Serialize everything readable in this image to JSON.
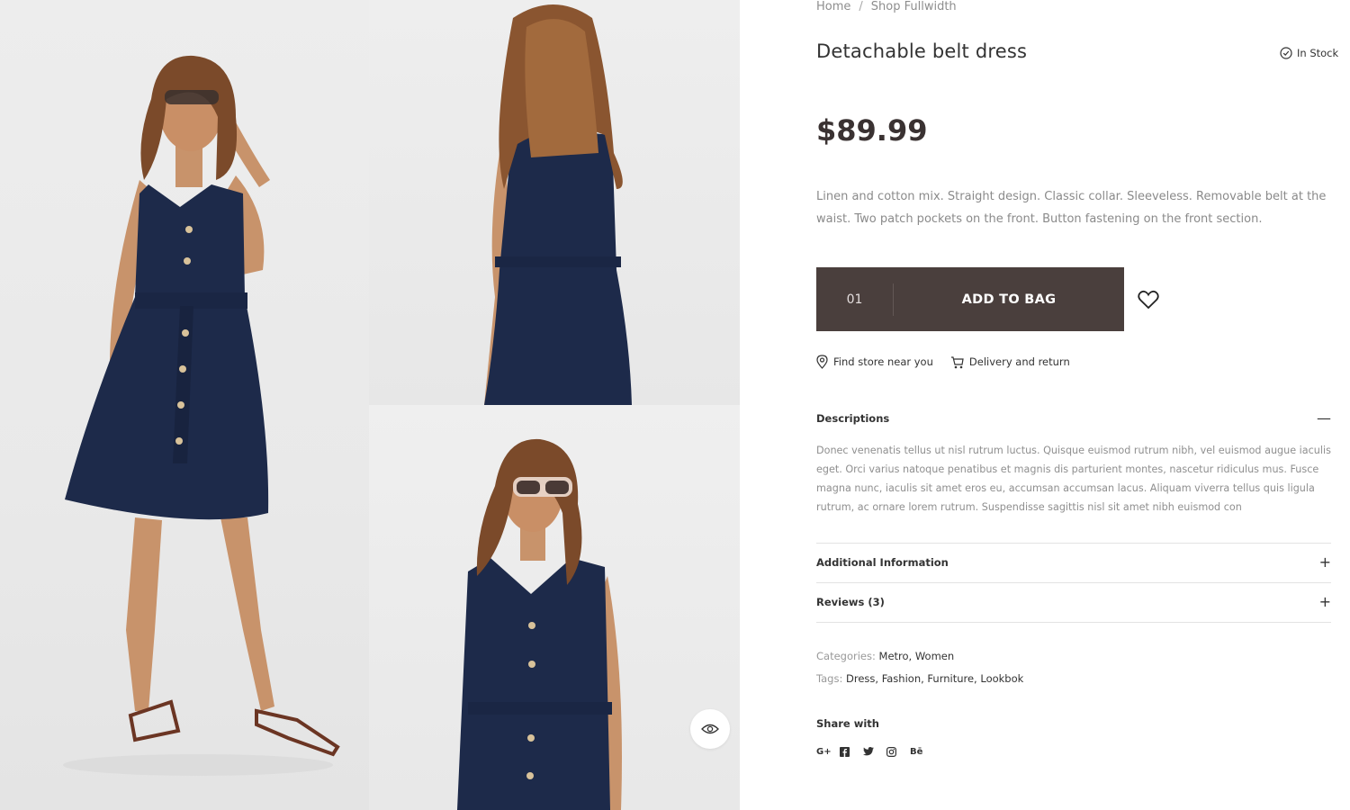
{
  "breadcrumb": {
    "home": "Home",
    "separator": "/",
    "current": "Shop Fullwidth"
  },
  "product": {
    "title": "Detachable belt dress",
    "stock_status": "In Stock",
    "price": "$89.99",
    "short_description": "Linen and cotton mix. Straight design. Classic collar. Sleeveless. Removable belt at the waist. Two patch pockets on the front. Button fastening on the front section."
  },
  "cart": {
    "quantity": "01",
    "add_label": "ADD TO BAG"
  },
  "links": {
    "find_store": "Find store near you",
    "delivery": "Delivery and return"
  },
  "accordion": {
    "descriptions": {
      "title": "Descriptions",
      "toggle": "—",
      "body": "Donec venenatis tellus ut nisl rutrum luctus. Quisque euismod rutrum nibh, vel euismod augue iaculis eget. Orci varius natoque penatibus et magnis dis parturient montes, nascetur ridiculus mus. Fusce magna nunc, iaculis sit amet eros eu, accumsan accumsan lacus. Aliquam viverra tellus quis ligula rutrum, ac ornare lorem rutrum. Suspendisse sagittis nisl sit amet nibh euismod con"
    },
    "additional": {
      "title": "Additional Information",
      "toggle": "+"
    },
    "reviews": {
      "title": "Reviews (3)",
      "toggle": "+"
    }
  },
  "meta": {
    "categories_label": "Categories:",
    "categories_value": "Metro, Women",
    "tags_label": "Tags:",
    "tags_value": "Dress, Fashion, Furniture, Lookbok"
  },
  "share": {
    "title": "Share with",
    "networks": {
      "google": "G+",
      "behance": "Bē"
    }
  },
  "icons": {
    "stock": "check-circle-icon",
    "wishlist": "heart-icon",
    "store": "map-pin-icon",
    "delivery": "cart-icon",
    "quick_view": "eye-icon"
  },
  "colors": {
    "button_bg": "#4a3f3d",
    "dress": "#1d2a4a",
    "text_dark": "#333333",
    "text_muted": "#8a8a8a"
  }
}
